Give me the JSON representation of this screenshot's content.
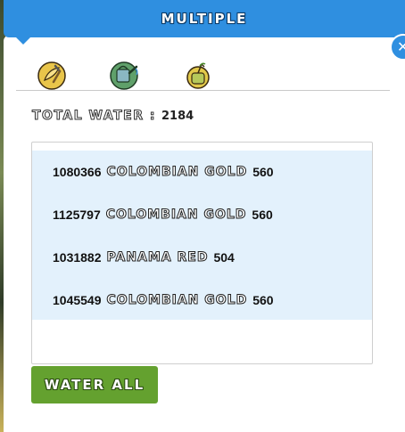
{
  "header": {
    "title": "MULTIPLE"
  },
  "tools": [
    {
      "icon": "harvest-icon"
    },
    {
      "icon": "watering-can-icon"
    },
    {
      "icon": "fertilizer-bag-icon"
    }
  ],
  "total": {
    "label": "TOTAL WATER :",
    "value": "2184"
  },
  "plants": [
    {
      "id": "1080366",
      "strain": "COLOMBIAN GOLD",
      "amount": "560"
    },
    {
      "id": "1125797",
      "strain": "COLOMBIAN GOLD",
      "amount": "560"
    },
    {
      "id": "1031882",
      "strain": "PANAMA RED",
      "amount": "504"
    },
    {
      "id": "1045549",
      "strain": "COLOMBIAN GOLD",
      "amount": "560"
    }
  ],
  "actions": {
    "water_all": "WATER ALL"
  },
  "colors": {
    "header": "#2f8fe0",
    "button": "#64a12f",
    "list_bg": "#e3f1fc"
  }
}
